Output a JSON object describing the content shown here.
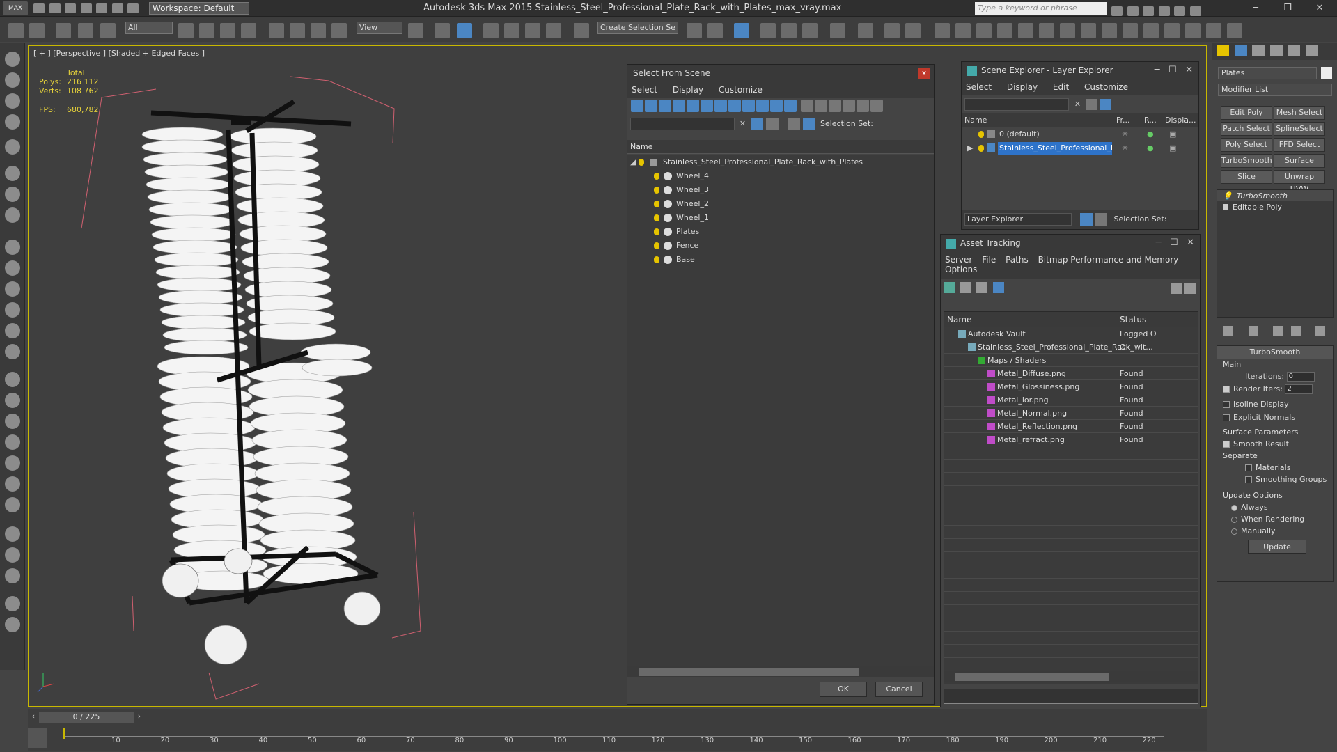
{
  "app": {
    "logo": "MAX",
    "workspace": "Workspace: Default",
    "title": "Autodesk 3ds Max  2015     Stainless_Steel_Professional_Plate_Rack_with_Plates_max_vray.max",
    "search_placeholder": "Type a keyword or phrase"
  },
  "toolbar": {
    "filter": "All",
    "refcoord": "View",
    "selset": "Create Selection Se"
  },
  "viewport": {
    "label": "[ + ] [Perspective ] [Shaded + Edged Faces ]",
    "stats": {
      "total_label": "Total",
      "polys_label": "Polys:",
      "polys": "216 112",
      "verts_label": "Verts:",
      "verts": "108 762",
      "fps_label": "FPS:",
      "fps": "680,782"
    }
  },
  "select_from_scene": {
    "title": "Select From Scene",
    "close": "x",
    "menus": [
      "Select",
      "Display",
      "Customize"
    ],
    "selection_set_label": "Selection Set:",
    "col_name": "Name",
    "root": "Stainless_Steel_Professional_Plate_Rack_with_Plates",
    "items": [
      "Wheel_4",
      "Wheel_3",
      "Wheel_2",
      "Wheel_1",
      "Plates",
      "Fence",
      "Base"
    ],
    "ok": "OK",
    "cancel": "Cancel"
  },
  "scene_explorer": {
    "title": "Scene Explorer - Layer Explorer",
    "menus": [
      "Select",
      "Display",
      "Edit",
      "Customize"
    ],
    "cols": [
      "Name",
      "Fr...",
      "R...",
      "Displa..."
    ],
    "rows": [
      "0 (default)",
      "Stainless_Steel_Professional_Pl..."
    ],
    "footer_combo": "Layer Explorer",
    "selection_set_label": "Selection Set:"
  },
  "asset_tracking": {
    "title": "Asset Tracking",
    "menus": [
      "Server",
      "File",
      "Paths",
      "Bitmap Performance and Memory"
    ],
    "menus2": [
      "Options"
    ],
    "col_name": "Name",
    "col_status": "Status",
    "rows": [
      {
        "name": "Autodesk Vault",
        "status": "Logged O",
        "indent": 0
      },
      {
        "name": "Stainless_Steel_Professional_Plate_Rack_wit...",
        "status": "Ok",
        "indent": 1
      },
      {
        "name": "Maps / Shaders",
        "status": "",
        "indent": 2
      },
      {
        "name": "Metal_Diffuse.png",
        "status": "Found",
        "indent": 3
      },
      {
        "name": "Metal_Glossiness.png",
        "status": "Found",
        "indent": 3
      },
      {
        "name": "Metal_ior.png",
        "status": "Found",
        "indent": 3
      },
      {
        "name": "Metal_Normal.png",
        "status": "Found",
        "indent": 3
      },
      {
        "name": "Metal_Reflection.png",
        "status": "Found",
        "indent": 3
      },
      {
        "name": "Metal_refract.png",
        "status": "Found",
        "indent": 3
      }
    ]
  },
  "command_panel": {
    "object_name": "Plates",
    "modifier_list": "Modifier List",
    "buttons": [
      "Edit Poly",
      "Mesh Select",
      "Patch Select",
      "SplineSelect",
      "Poly Select",
      "FFD Select",
      "TurboSmooth",
      "Surface Select",
      "Slice",
      "Unwrap UVW"
    ],
    "stack": [
      "TurboSmooth",
      "Editable Poly"
    ],
    "rollout_title": "TurboSmooth",
    "main_label": "Main",
    "iterations_label": "Iterations:",
    "iterations": "0",
    "render_iters_label": "Render Iters:",
    "render_iters": "2",
    "isoline": "Isoline Display",
    "explicit_normals": "Explicit Normals",
    "surface_params": "Surface Parameters",
    "smooth_result": "Smooth Result",
    "separate": "Separate",
    "materials": "Materials",
    "smoothing_groups": "Smoothing Groups",
    "update_options": "Update Options",
    "always": "Always",
    "when_rendering": "When Rendering",
    "manually": "Manually",
    "update": "Update"
  },
  "timeline": {
    "frame": "0 / 225",
    "ticks": [
      "10",
      "20",
      "30",
      "40",
      "50",
      "60",
      "70",
      "80",
      "90",
      "100",
      "110",
      "120",
      "130",
      "140",
      "150",
      "160",
      "170",
      "180",
      "190",
      "200",
      "210",
      "220"
    ]
  },
  "colors": {
    "accent_blue": "#4b86c3",
    "viewport_border": "#c8b800",
    "stat_yellow": "#e6d23a"
  }
}
